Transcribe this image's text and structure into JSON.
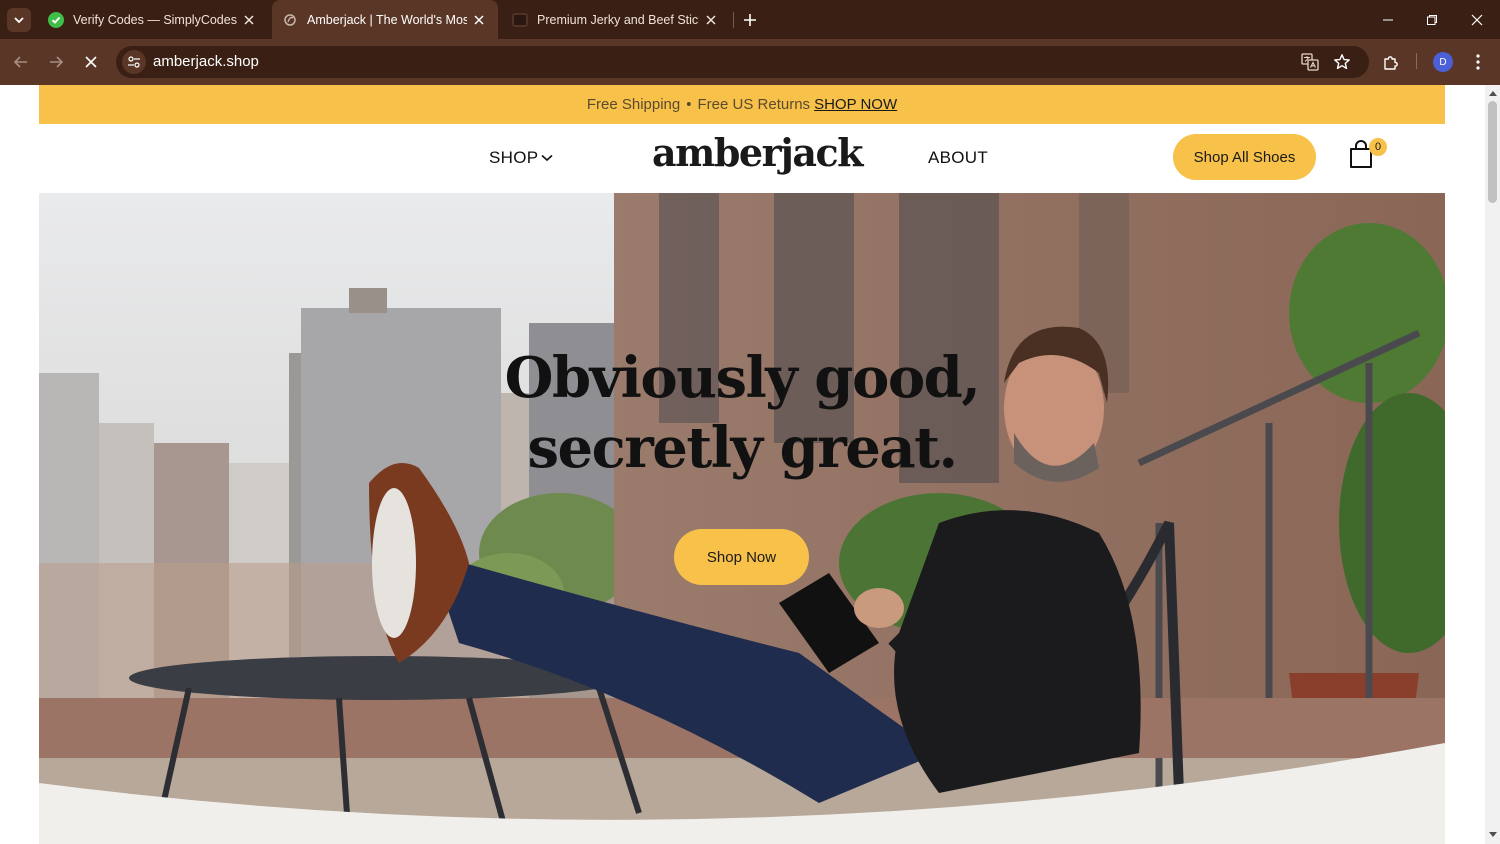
{
  "browser": {
    "tabs": [
      {
        "title": "Verify Codes — SimplyCodes",
        "icon": "simplycodes-icon",
        "active": false
      },
      {
        "title": "Amberjack | The World's Most A",
        "icon": "amberjack-favicon",
        "active": true
      },
      {
        "title": "Premium Jerky and Beef Sticks |",
        "icon": "jerky-favicon",
        "active": false
      }
    ],
    "url": "amberjack.shop",
    "profile_initial": "D",
    "accent": "#5a3626",
    "tabbar_color": "#3a1f14"
  },
  "promo": {
    "text_shipping": "Free Shipping",
    "separator": "•",
    "text_returns": "Free US Returns",
    "link": "SHOP NOW",
    "background": "#f8c14a"
  },
  "header": {
    "nav_shop": "SHOP",
    "logo": "amberjack",
    "nav_about": "ABOUT",
    "cta": "Shop All Shoes",
    "cart_count": "0"
  },
  "hero": {
    "headline_line1": "Obviously good,",
    "headline_line2": "secretly great.",
    "cta": "Shop Now"
  }
}
